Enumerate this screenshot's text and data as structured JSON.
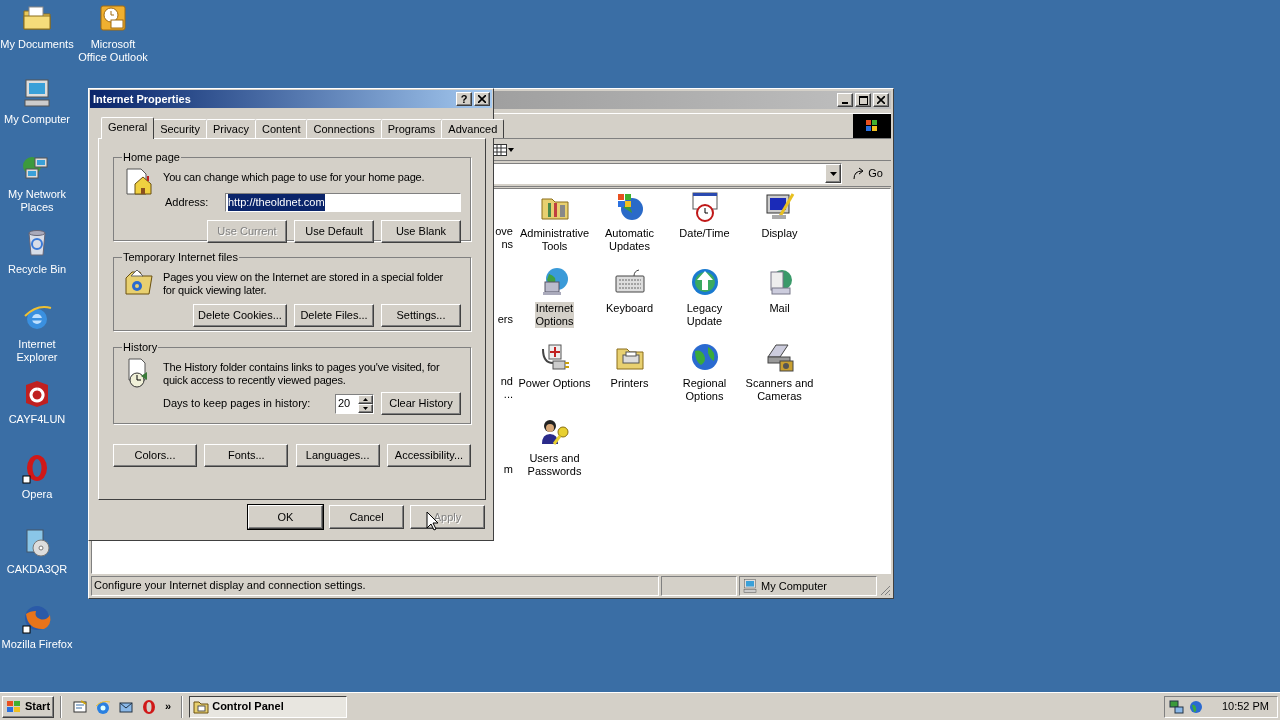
{
  "desktop_icons": [
    {
      "kind": "documents",
      "label": "My Documents"
    },
    {
      "kind": "outlook",
      "label": "Microsoft\nOffice Outlook"
    },
    {
      "kind": "computer",
      "label": "My Computer"
    },
    {
      "kind": "network",
      "label": "My Network\nPlaces"
    },
    {
      "kind": "recycle",
      "label": "Recycle Bin"
    },
    {
      "kind": "ie",
      "label": "Internet\nExplorer"
    },
    {
      "kind": "cube",
      "label": "CAYF4LUN"
    },
    {
      "kind": "opera",
      "label": "Opera"
    },
    {
      "kind": "installer",
      "label": "CAKDA3QR"
    },
    {
      "kind": "firefox",
      "label": "Mozilla Firefox"
    }
  ],
  "control_panel_window": {
    "go_button": "Go",
    "partial_items": [
      {
        "line1": "ove",
        "line2": "ns"
      },
      {
        "line2": "ers"
      },
      {
        "line1": "nd",
        "line2": "..."
      },
      {
        "line2": "m"
      }
    ],
    "items": [
      {
        "kind": "admin",
        "label": "Administrative\nTools",
        "selected": false
      },
      {
        "kind": "updates",
        "label": "Automatic\nUpdates",
        "selected": false
      },
      {
        "kind": "datetime",
        "label": "Date/Time",
        "selected": false
      },
      {
        "kind": "display",
        "label": "Display",
        "selected": false
      },
      {
        "kind": "internet",
        "label": "Internet\nOptions",
        "selected": true
      },
      {
        "kind": "keyboard",
        "label": "Keyboard",
        "selected": false
      },
      {
        "kind": "legacy",
        "label": "Legacy\nUpdate",
        "selected": false
      },
      {
        "kind": "mail",
        "label": "Mail",
        "selected": false
      },
      {
        "kind": "power",
        "label": "Power Options",
        "selected": false
      },
      {
        "kind": "printers",
        "label": "Printers",
        "selected": false
      },
      {
        "kind": "regional",
        "label": "Regional\nOptions",
        "selected": false
      },
      {
        "kind": "scanner",
        "label": "Scanners and\nCameras",
        "selected": false
      },
      {
        "kind": "users",
        "label": "Users and\nPasswords",
        "selected": false
      }
    ],
    "status_text": "Configure your Internet display and connection settings.",
    "status_zone": "My Computer"
  },
  "dialog": {
    "title": "Internet Properties",
    "help_button": "?",
    "tabs": [
      {
        "label": "General",
        "selected": true
      },
      {
        "label": "Security",
        "selected": false
      },
      {
        "label": "Privacy",
        "selected": false
      },
      {
        "label": "Content",
        "selected": false
      },
      {
        "label": "Connections",
        "selected": false
      },
      {
        "label": "Programs",
        "selected": false
      },
      {
        "label": "Advanced",
        "selected": false
      }
    ],
    "home_page": {
      "legend": "Home page",
      "text": "You can change which page to use for your home page.",
      "address_label": "Address:",
      "address_value": "http://theoldnet.com",
      "address_selected": true,
      "buttons": [
        {
          "label": "Use Current",
          "disabled": true
        },
        {
          "label": "Use Default",
          "disabled": false
        },
        {
          "label": "Use Blank",
          "disabled": false
        }
      ]
    },
    "temp_files": {
      "legend": "Temporary Internet files",
      "text": "Pages you view on the Internet are stored in a special folder\nfor quick viewing later.",
      "buttons": [
        {
          "label": "Delete Cookies...",
          "disabled": false
        },
        {
          "label": "Delete Files...",
          "disabled": false
        },
        {
          "label": "Settings...",
          "disabled": false
        }
      ]
    },
    "history": {
      "legend": "History",
      "text": "The History folder contains links to pages you've visited, for\nquick access to recently viewed pages.",
      "days_label": "Days to keep pages in history:",
      "days_value": "20",
      "buttons": [
        {
          "label": "Clear History",
          "disabled": false
        }
      ]
    },
    "bottom_buttons": [
      {
        "label": "Colors...",
        "disabled": false
      },
      {
        "label": "Fonts...",
        "disabled": false
      },
      {
        "label": "Languages...",
        "disabled": false
      },
      {
        "label": "Accessibility...",
        "disabled": false
      }
    ],
    "footer_buttons": [
      {
        "label": "OK",
        "disabled": false,
        "default": true
      },
      {
        "label": "Cancel",
        "disabled": false,
        "default": false
      },
      {
        "label": "Apply",
        "disabled": true,
        "default": false
      }
    ]
  },
  "taskbar": {
    "start": "Start",
    "overflow": "»",
    "tasks": [
      {
        "label": "Control Panel",
        "selected": true
      }
    ],
    "clock": "10:52 PM"
  }
}
